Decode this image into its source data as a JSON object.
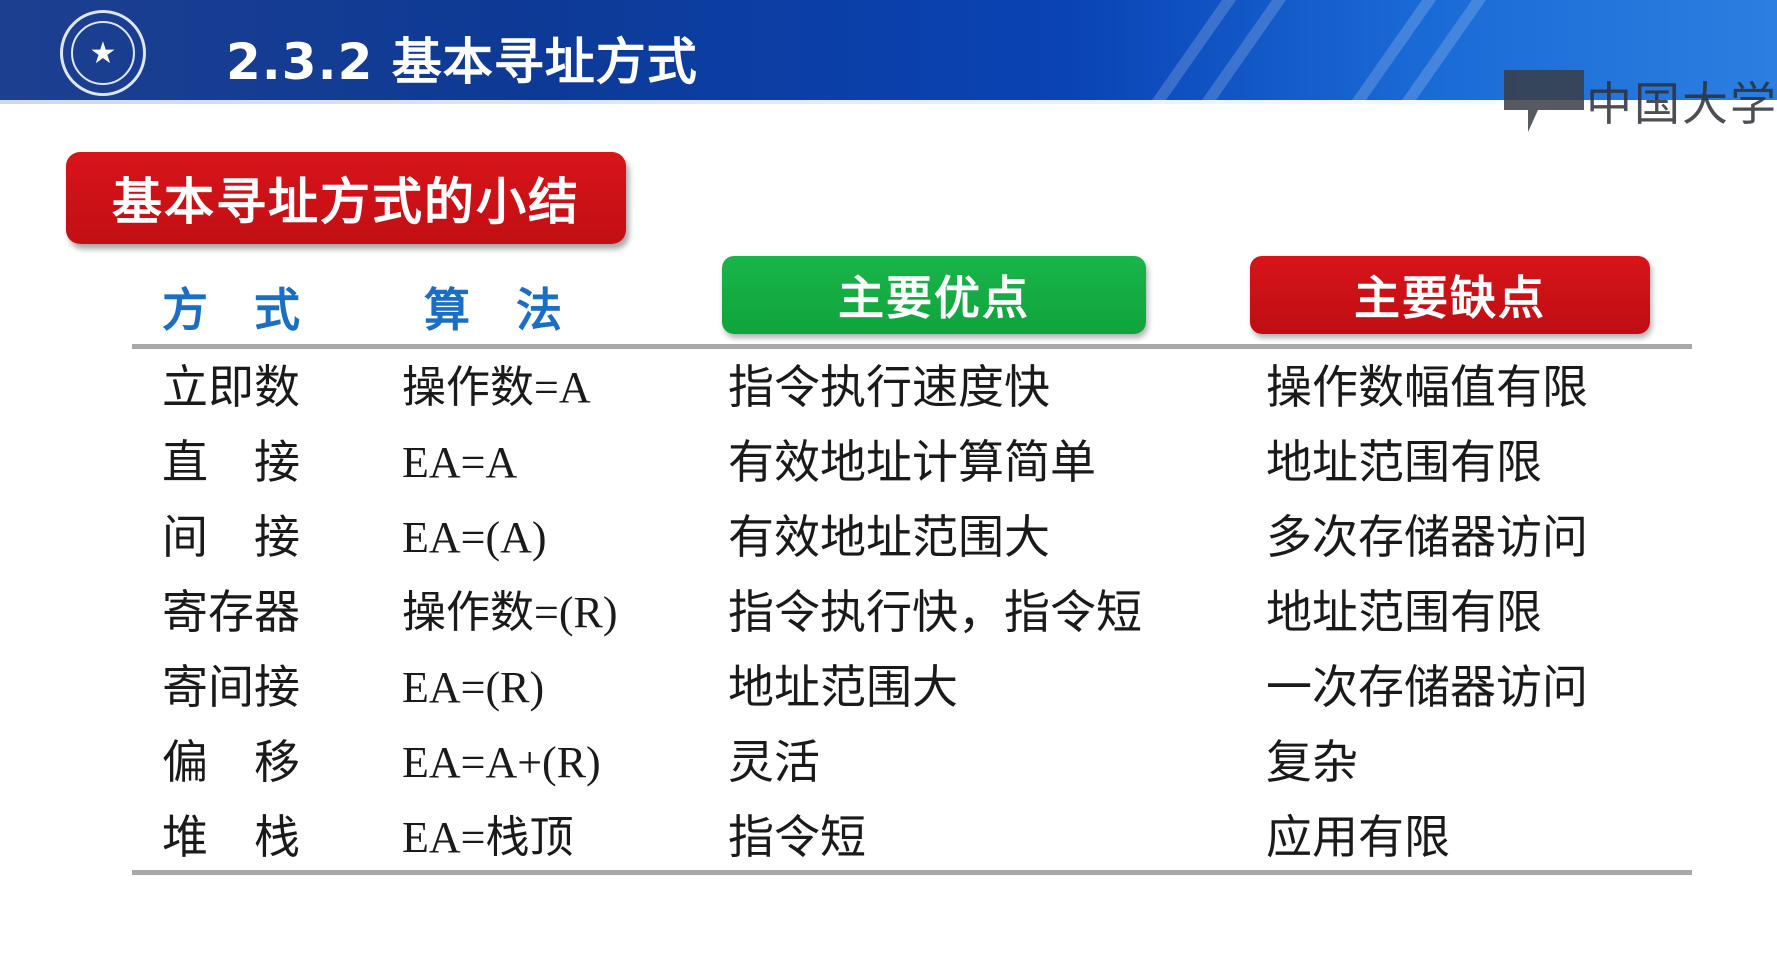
{
  "header": {
    "title": "2.3.2 基本寻址方式",
    "logo_text": "中国大学"
  },
  "summary_label": "基本寻址方式的小结",
  "columns": {
    "mode": "方　式",
    "algorithm": "算　法",
    "advantage": "主要优点",
    "disadvantage": "主要缺点"
  },
  "rows": [
    {
      "mode": "立即数",
      "algorithm": "操作数=A",
      "advantage": "指令执行速度快",
      "disadvantage": "操作数幅值有限"
    },
    {
      "mode": "直　接",
      "algorithm": "EA=A",
      "advantage": "有效地址计算简单",
      "disadvantage": "地址范围有限"
    },
    {
      "mode": "间　接",
      "algorithm": "EA=(A)",
      "advantage": "有效地址范围大",
      "disadvantage": "多次存储器访问"
    },
    {
      "mode": "寄存器",
      "algorithm": "操作数=(R)",
      "advantage": "指令执行快，指令短",
      "disadvantage": "地址范围有限"
    },
    {
      "mode": "寄间接",
      "algorithm": "EA=(R)",
      "advantage": "地址范围大",
      "disadvantage": "一次存储器访问"
    },
    {
      "mode": "偏　移",
      "algorithm": "EA=A+(R)",
      "advantage": "灵活",
      "disadvantage": "复杂"
    },
    {
      "mode": "堆　栈",
      "algorithm": "EA=栈顶",
      "advantage": "指令短",
      "disadvantage": "应用有限"
    }
  ],
  "colors": {
    "header_blue": "#0d3a96",
    "badge_red": "#c10f14",
    "pill_green": "#0fa43c",
    "column_heading_blue": "#1a6fc4"
  },
  "icons": {
    "seal": "university-seal-icon",
    "mooc": "mooc-logo-icon"
  }
}
